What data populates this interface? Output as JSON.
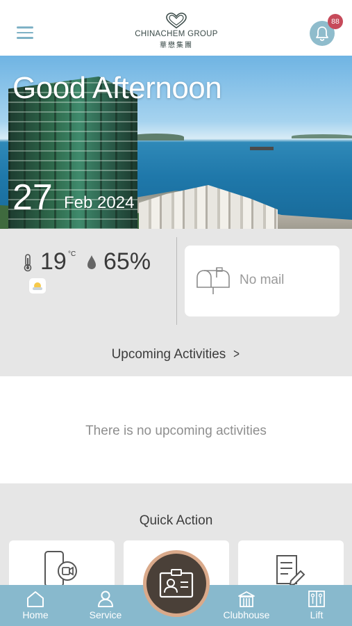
{
  "header": {
    "logo_en": "CHINACHEM GROUP",
    "logo_zh": "華懋集團",
    "notification_count": "88"
  },
  "hero": {
    "greeting": "Good Afternoon",
    "day": "27",
    "month_year": "Feb 2024"
  },
  "weather": {
    "temperature": "19",
    "temp_unit": "°C",
    "humidity": "65%"
  },
  "mail": {
    "status": "No mail"
  },
  "activities": {
    "header": "Upcoming Activities",
    "empty_text": "There is no upcoming activities"
  },
  "quick_action": {
    "title": "Quick Action"
  },
  "tabbar": {
    "items": [
      {
        "label": "Home",
        "icon": "home-icon"
      },
      {
        "label": "Service",
        "icon": "person-icon"
      },
      {
        "label": "",
        "icon": "visitor-card-icon"
      },
      {
        "label": "Clubhouse",
        "icon": "building-icon"
      },
      {
        "label": "Lift",
        "icon": "lift-icon"
      }
    ]
  },
  "colors": {
    "accent": "#88b9cd",
    "badge": "#c64a5a",
    "fab_ring": "#d9a98a",
    "fab_center": "#4a4038",
    "band_grey": "#e6e6e6"
  }
}
